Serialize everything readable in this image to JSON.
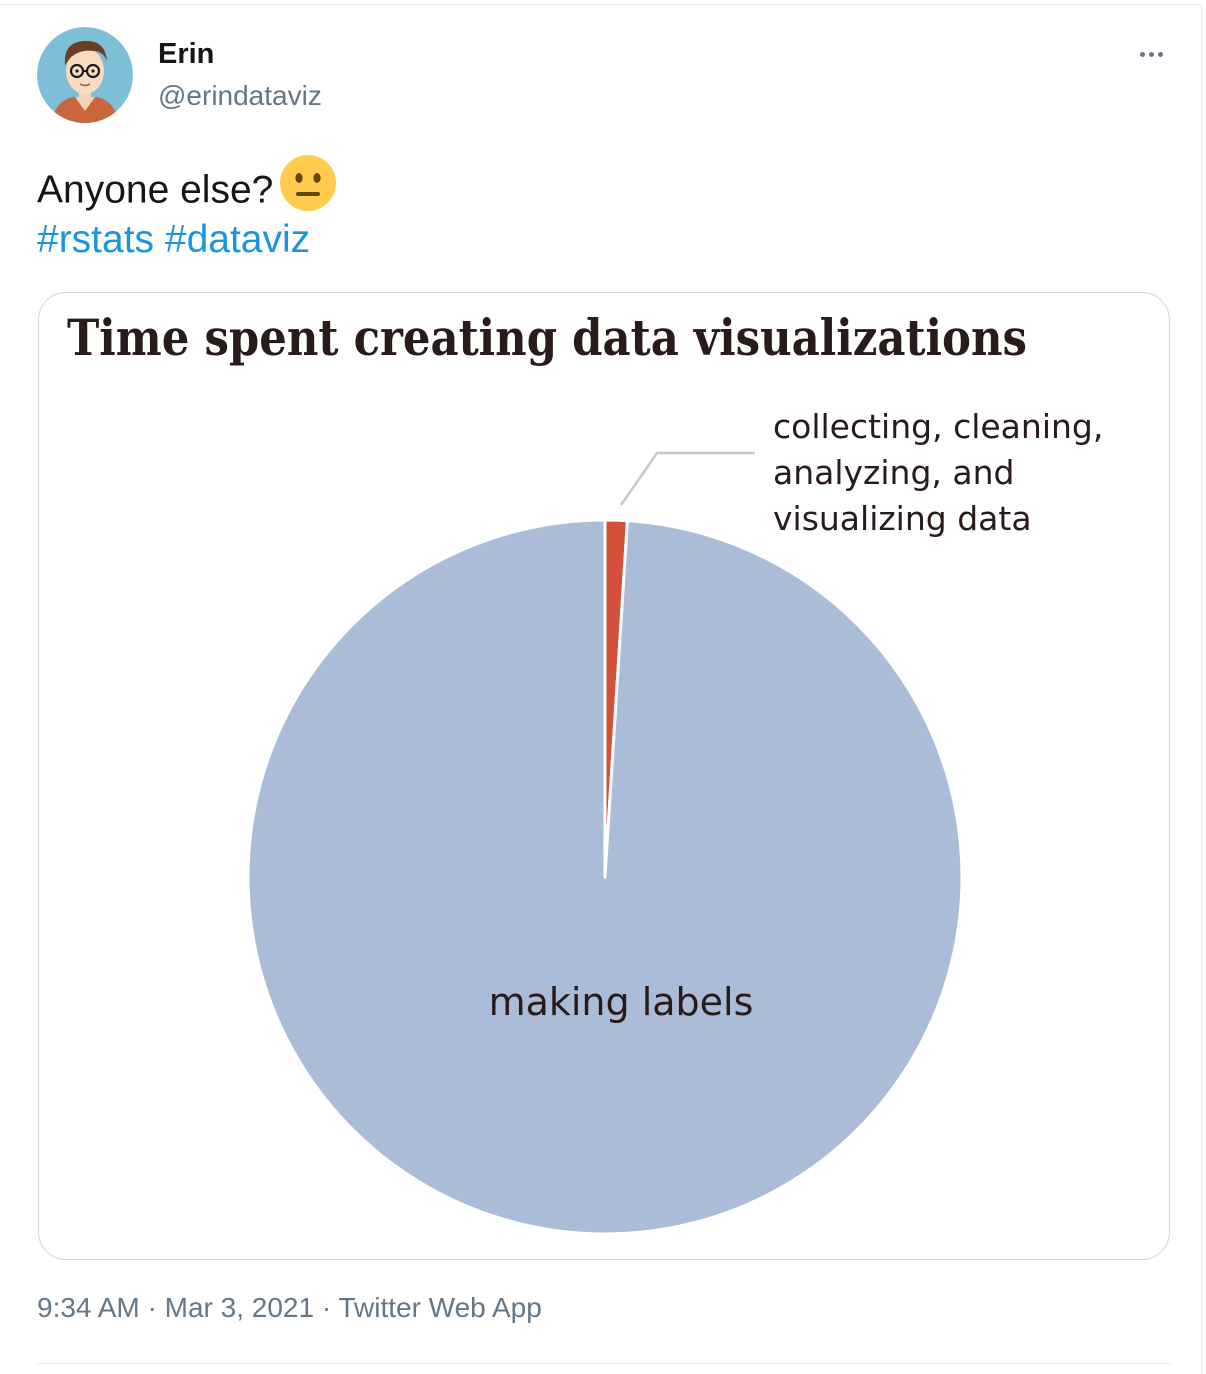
{
  "author": {
    "display_name": "Erin",
    "handle": "@erindataviz",
    "avatar_icon": "cartoon-avatar-with-glasses"
  },
  "more_menu_icon": "more-horizontal-icon",
  "tweet": {
    "text": "Anyone else?",
    "emoji_icon": "neutral-face-emoji",
    "hashtags": [
      "#rstats",
      "#dataviz"
    ]
  },
  "meta": {
    "time": "9:34 AM",
    "date": "Mar 3, 2021",
    "source": "Twitter Web App",
    "separator": "·"
  },
  "colors": {
    "link": "#1b95e0",
    "pie_main": "#aabcd8",
    "pie_small": "#d3513b",
    "chart_text": "#2a1b1b"
  },
  "chart_data": {
    "type": "pie",
    "title": "Time spent creating data visualizations",
    "start_angle": "top (12 o'clock), clockwise",
    "slices": [
      {
        "label": "collecting, cleaning, analyzing, and visualizing data",
        "label_lines": [
          "collecting, cleaning,",
          "analyzing, and",
          "visualizing data"
        ],
        "value": 1,
        "color": "#d3513b",
        "label_placement": "outside with leader line"
      },
      {
        "label": "making labels",
        "value": 99,
        "color": "#aabcd8",
        "label_placement": "inside"
      }
    ]
  }
}
